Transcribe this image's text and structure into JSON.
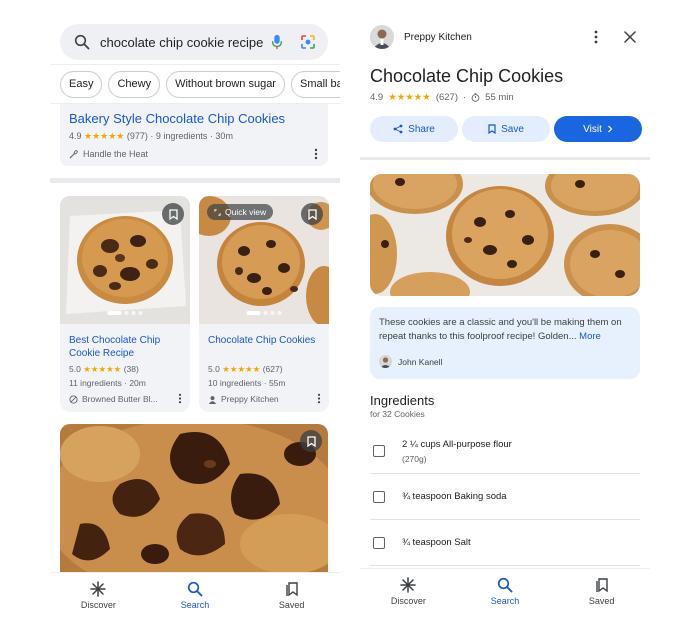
{
  "left_screen": {
    "search": {
      "query": "chocolate chip cookie recipe"
    },
    "chips": [
      "Easy",
      "Chewy",
      "Without brown sugar",
      "Small batch"
    ],
    "top_result": {
      "title": "Bakery Style Chocolate Chip Cookies",
      "rating": "4.9",
      "stars": "★★★★★",
      "meta": "(977) · 9 ingredients · 30m",
      "source": "Handle the Heat"
    },
    "cards": [
      {
        "title": "Best Chocolate Chip Cookie Recipe",
        "rating": "5.0",
        "stars": "★★★★★",
        "reviews": "(38)",
        "meta": "11 ingredients · 20m",
        "source": "Browned Butter Bl..."
      },
      {
        "quick_view": "Quick view",
        "title": "Chocolate Chip Cookies",
        "rating": "5.0",
        "stars": "★★★★★",
        "reviews": "(627)",
        "meta": "10 ingredients · 55m",
        "source": "Preppy Kitchen"
      }
    ],
    "nav": [
      {
        "label": "Discover",
        "icon": "asterisk-icon",
        "active": false
      },
      {
        "label": "Search",
        "icon": "search-icon",
        "active": true
      },
      {
        "label": "Saved",
        "icon": "saved-icon",
        "active": false
      }
    ]
  },
  "right_screen": {
    "source_name": "Preppy Kitchen",
    "title": "Chocolate Chip Cookies",
    "rating": "4.9",
    "stars": "★★★★★",
    "reviews": "(627)",
    "time": "55 min",
    "buttons": {
      "share": "Share",
      "save": "Save",
      "visit": "Visit"
    },
    "description": "These cookies are a classic and you'll be making them on repeat thanks to this foolproof recipe! Golden...",
    "more_link": "More",
    "author": "John Kanell",
    "ingredients_title": "Ingredients",
    "ingredients_sub": "for 32 Cookies",
    "ingredients": [
      {
        "label": "2 ¼ cups All-purpose flour",
        "sub": "(270g)"
      },
      {
        "label": "¾ teaspoon Baking soda",
        "sub": ""
      },
      {
        "label": "¾ teaspoon Salt",
        "sub": ""
      }
    ],
    "nav": [
      {
        "label": "Discover",
        "icon": "asterisk-icon",
        "active": false
      },
      {
        "label": "Search",
        "icon": "search-icon",
        "active": true
      },
      {
        "label": "Saved",
        "icon": "saved-icon",
        "active": false
      }
    ]
  },
  "colors": {
    "link_blue": "#1a57c9",
    "star_yellow": "#f2a600",
    "visit_button": "#1a66e0",
    "card_bg": "#f1f3f7"
  }
}
